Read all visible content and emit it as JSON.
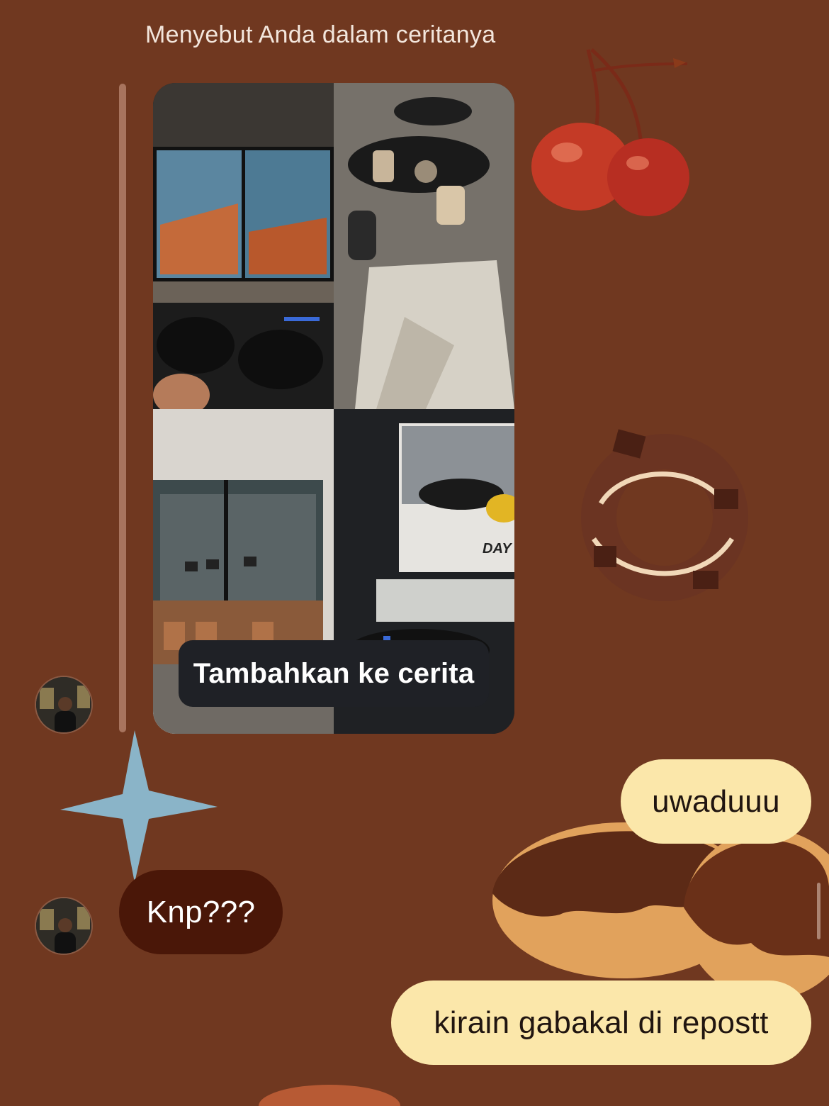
{
  "thread": {
    "mention_header": "Menyebut Anda dalam ceritanya",
    "story_add_button": "Tambahkan ke cerita",
    "story_tiles": [
      {
        "name": "gaming-screen-photo",
        "screen_text": ""
      },
      {
        "name": "cafe-table-drinks-photo"
      },
      {
        "name": "cafe-interior-photo"
      },
      {
        "name": "racing-game-photo",
        "screen_text": "DAY"
      }
    ]
  },
  "messages": [
    {
      "side": "outgoing",
      "text": "uwaduuu"
    },
    {
      "side": "incoming",
      "text": "Knp???"
    },
    {
      "side": "outgoing",
      "text": "kirain gabakal di repostt"
    }
  ],
  "theme": {
    "background": "#703820",
    "incoming_bubble": "#4a1708",
    "outgoing_bubble": "#fbe7aa",
    "stickers": [
      "cherries-sticker",
      "donut-sticker",
      "sparkle-star-sticker",
      "chocolate-donuts-sticker",
      "pastry-sticker"
    ]
  }
}
